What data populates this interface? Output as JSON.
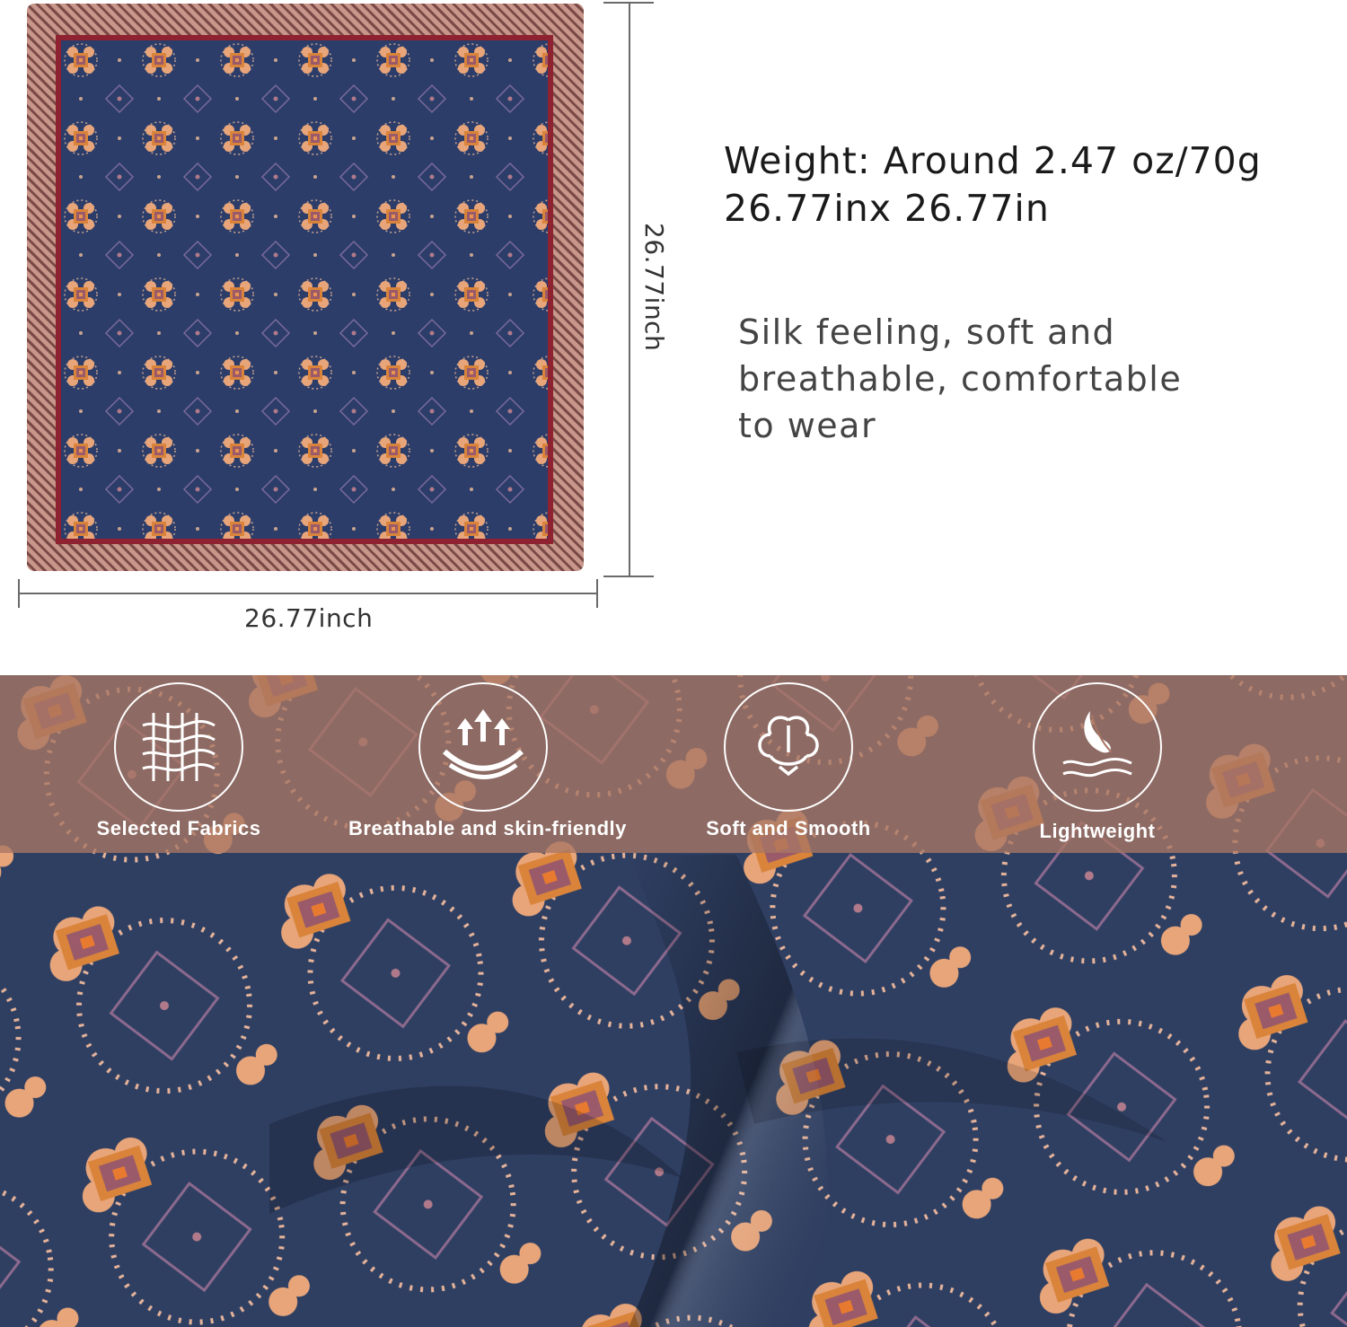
{
  "specs": {
    "weight": "Weight:  Around 2.47 oz/70g",
    "size": "26.77inx 26.77in"
  },
  "description": {
    "line1": "Silk feeling, soft and",
    "line2": "breathable, comfortable",
    "line3": "to wear"
  },
  "dimensions": {
    "width_label": "26.77inch",
    "height_label": "26.77inch"
  },
  "features": [
    {
      "label": "Selected Fabrics",
      "icon": "fabric-weave-icon"
    },
    {
      "label": "Breathable and skin-friendly",
      "icon": "breathable-arrows-icon"
    },
    {
      "label": "Soft and Smooth",
      "icon": "cotton-boll-icon"
    },
    {
      "label": "Lightweight",
      "icon": "feather-icon"
    }
  ],
  "colors": {
    "navy": "#2c3d6a",
    "burgundy": "#8e2230",
    "border_tan": "#c8968a",
    "accent_orange": "#d9843a",
    "band": "#a87664"
  }
}
